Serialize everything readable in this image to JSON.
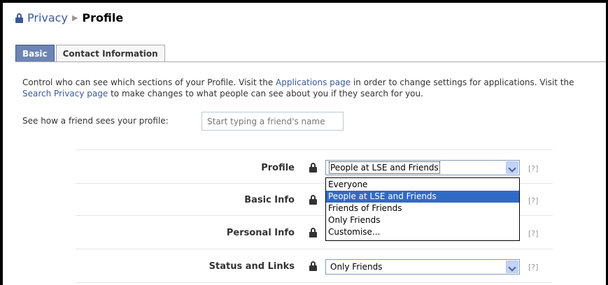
{
  "breadcrumb": {
    "parent": "Privacy",
    "current": "Profile"
  },
  "tabs": [
    {
      "label": "Basic",
      "active": true
    },
    {
      "label": "Contact Information",
      "active": false
    }
  ],
  "description": {
    "part1": "Control who can see which sections of your Profile. Visit the ",
    "link1": "Applications page",
    "part2": " in order to change settings for applications. Visit the ",
    "link2": "Search Privacy page",
    "part3": " to make changes to what people can see about you if they search for you."
  },
  "preview": {
    "label": "See how a friend sees your profile:",
    "placeholder": "Start typing a friend's name"
  },
  "rows": [
    {
      "label": "Profile",
      "value": "People at LSE and Friends",
      "help": "[?]"
    },
    {
      "label": "Basic Info",
      "value": "",
      "help": "[?]"
    },
    {
      "label": "Personal Info",
      "value": "",
      "help": "[?]"
    },
    {
      "label": "Status and Links",
      "value": "Only Friends",
      "help": "[?]"
    }
  ],
  "dropdown": {
    "options": [
      "Everyone",
      "People at LSE and Friends",
      "Friends of Friends",
      "Only Friends",
      "Customise..."
    ],
    "selected_index": 1
  },
  "colors": {
    "accent": "#3b5998",
    "tab_active": "#6d84b4",
    "selection": "#316ac5"
  },
  "icons": {
    "lock": "lock-icon",
    "arrow": "chevron-down-icon"
  }
}
